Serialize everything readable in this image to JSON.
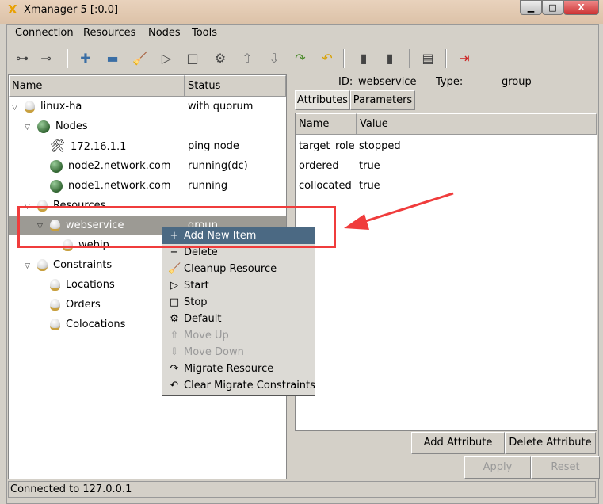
{
  "window": {
    "title": "Xmanager 5 [:0.0]",
    "minimize": "▁",
    "maximize": "□",
    "close": "X"
  },
  "menubar": [
    "Connection",
    "Resources",
    "Nodes",
    "Tools"
  ],
  "toolbar": [
    "connect-icon",
    "disconnect-icon",
    "add-icon",
    "remove-icon",
    "cleanup-icon",
    "start-icon",
    "stop-icon",
    "default-icon",
    "move-up-icon",
    "move-down-icon",
    "migrate-icon",
    "clear-migrate-icon",
    "standby-icon",
    "active-icon",
    "log-icon",
    "exit-icon"
  ],
  "tree": {
    "columns": [
      "Name",
      "Status"
    ],
    "rows": [
      {
        "name": "linux-ha",
        "status": "with quorum",
        "level": 0,
        "icon": "bulb",
        "expand": true
      },
      {
        "name": "Nodes",
        "status": "",
        "level": 1,
        "icon": "ball",
        "expand": true
      },
      {
        "name": "172.16.1.1",
        "status": "ping node",
        "level": 2,
        "icon": "tools"
      },
      {
        "name": "node2.network.com",
        "status": "running(dc)",
        "level": 2,
        "icon": "ball"
      },
      {
        "name": "node1.network.com",
        "status": "running",
        "level": 2,
        "icon": "ball"
      },
      {
        "name": "Resources",
        "status": "",
        "level": 1,
        "icon": "bulb",
        "expand": true
      },
      {
        "name": "webservice",
        "status": "group",
        "level": 2,
        "icon": "bulb",
        "expand": true,
        "selected": true
      },
      {
        "name": "webip",
        "status": "",
        "level": 3,
        "icon": "bulb"
      },
      {
        "name": "Constraints",
        "status": "",
        "level": 1,
        "icon": "bulb",
        "expand": true
      },
      {
        "name": "Locations",
        "status": "",
        "level": 2,
        "icon": "bulb"
      },
      {
        "name": "Orders",
        "status": "",
        "level": 2,
        "icon": "bulb"
      },
      {
        "name": "Colocations",
        "status": "",
        "level": 2,
        "icon": "bulb"
      }
    ]
  },
  "details": {
    "id_label": "ID:",
    "id_value": "webservice",
    "type_label": "Type:",
    "type_value": "group",
    "tabs": [
      "Attributes",
      "Parameters"
    ],
    "columns": [
      "Name",
      "Value"
    ],
    "rows": [
      [
        "target_role",
        "stopped"
      ],
      [
        "ordered",
        "true"
      ],
      [
        "collocated",
        "true"
      ]
    ],
    "add_attribute": "Add Attribute",
    "delete_attribute": "Delete Attribute",
    "apply": "Apply",
    "reset": "Reset"
  },
  "context_menu": [
    {
      "label": "Add New Item",
      "icon": "+",
      "highlighted": true
    },
    {
      "label": "Delete",
      "icon": "−"
    },
    {
      "label": "Cleanup Resource",
      "icon": "🧹"
    },
    {
      "label": "Start",
      "icon": "▷"
    },
    {
      "label": "Stop",
      "icon": "□"
    },
    {
      "label": "Default",
      "icon": "⚙"
    },
    {
      "label": "Move Up",
      "icon": "⇧",
      "disabled": true
    },
    {
      "label": "Move Down",
      "icon": "⇩",
      "disabled": true
    },
    {
      "label": "Migrate Resource",
      "icon": "↷"
    },
    {
      "label": "Clear Migrate Constraints",
      "icon": "↶"
    }
  ],
  "status_bar": "Connected to 127.0.0.1",
  "colors": {
    "highlight": "#4b6983",
    "annotation": "#f03c3c",
    "selected_row": "#9c9a94"
  }
}
